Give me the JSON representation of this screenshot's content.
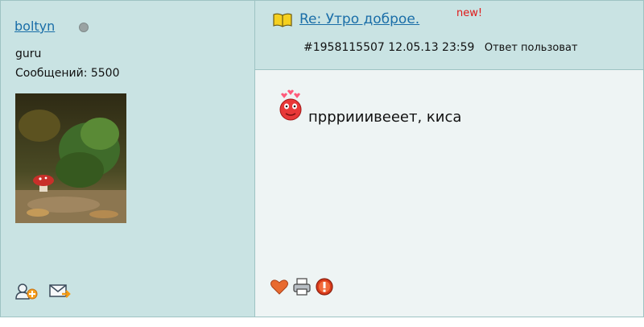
{
  "author": {
    "username": "boltyn",
    "status_icon": "status-offline-dot",
    "rank": "guru",
    "posts_label": "Сообщений: 5500",
    "avatar_icon": "mushroom-photo"
  },
  "post": {
    "title": "Re: Утро доброе.",
    "new_badge": "new!",
    "meta_id_time": "#1958115507 12.05.13 23:59",
    "meta_reply": "Ответ пользоват",
    "message": "прррииивееет, киса",
    "smiley_icon": "love-smiley"
  },
  "actions": {
    "side": [
      "add-friend-icon",
      "send-message-icon"
    ],
    "post": [
      "heart-icon",
      "print-icon",
      "report-icon"
    ]
  },
  "colors": {
    "panel": "#c9e3e3",
    "body": "#eef4f4",
    "link": "#1a6ea8",
    "new": "#e01818"
  }
}
